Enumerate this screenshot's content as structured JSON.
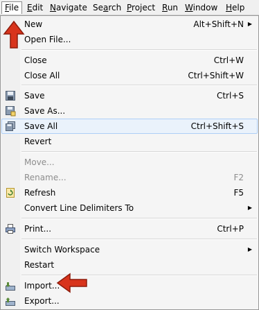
{
  "menubar": {
    "items": [
      {
        "label": "File",
        "mnemonic": "F"
      },
      {
        "label": "Edit",
        "mnemonic": "E"
      },
      {
        "label": "Navigate",
        "mnemonic": "N"
      },
      {
        "label": "Search",
        "mnemonic": "a"
      },
      {
        "label": "Project",
        "mnemonic": "P"
      },
      {
        "label": "Run",
        "mnemonic": "R"
      },
      {
        "label": "Window",
        "mnemonic": "W"
      },
      {
        "label": "Help",
        "mnemonic": "H"
      }
    ],
    "active": "File"
  },
  "file_menu": {
    "new": {
      "label": "New",
      "shortcut": "Alt+Shift+N"
    },
    "open_file": {
      "label": "Open File..."
    },
    "close": {
      "label": "Close",
      "shortcut": "Ctrl+W"
    },
    "close_all": {
      "label": "Close All",
      "shortcut": "Ctrl+Shift+W"
    },
    "save": {
      "label": "Save",
      "shortcut": "Ctrl+S"
    },
    "save_as": {
      "label": "Save As..."
    },
    "save_all": {
      "label": "Save All",
      "shortcut": "Ctrl+Shift+S"
    },
    "revert": {
      "label": "Revert"
    },
    "move": {
      "label": "Move..."
    },
    "rename": {
      "label": "Rename...",
      "shortcut": "F2"
    },
    "refresh": {
      "label": "Refresh",
      "shortcut": "F5"
    },
    "convert": {
      "label": "Convert Line Delimiters To"
    },
    "print": {
      "label": "Print...",
      "shortcut": "Ctrl+P"
    },
    "switch_workspace": {
      "label": "Switch Workspace"
    },
    "restart": {
      "label": "Restart"
    },
    "import": {
      "label": "Import..."
    },
    "export": {
      "label": "Export..."
    }
  },
  "colors": {
    "annotation_arrow": "#d8341c",
    "highlight": "#eaf2fb",
    "disabled_text": "#8d8d8d"
  }
}
